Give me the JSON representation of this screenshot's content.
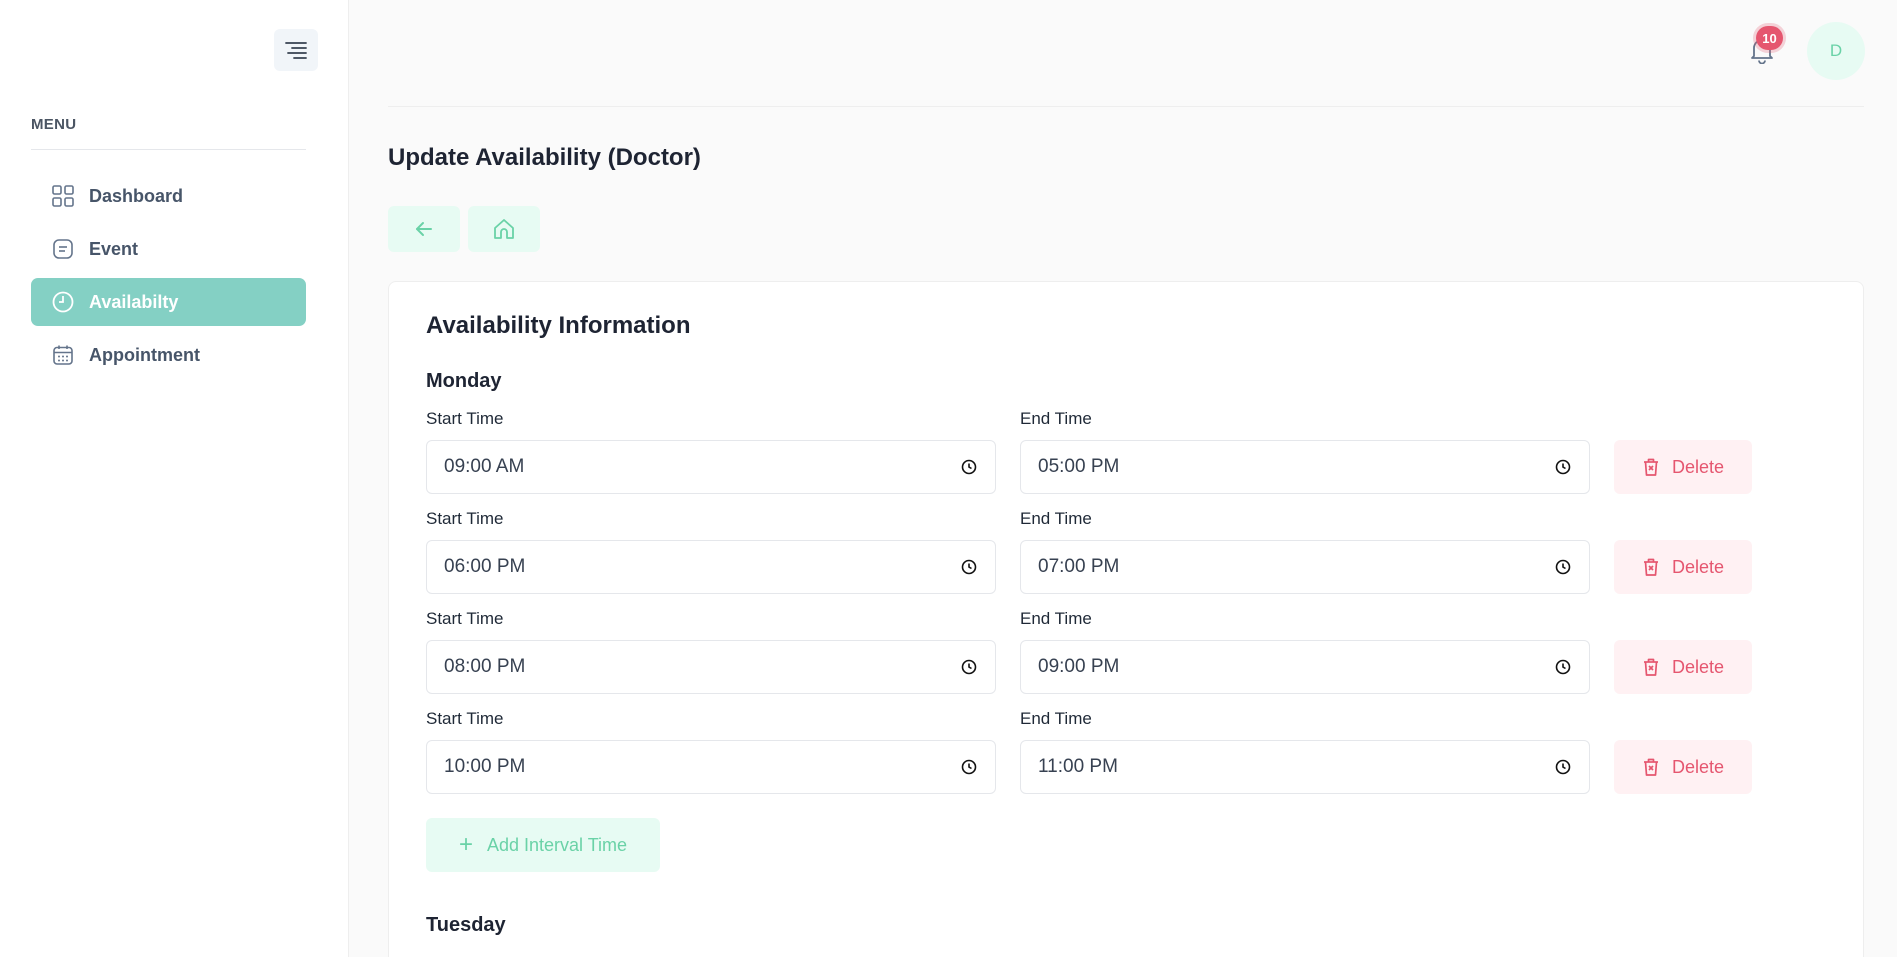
{
  "sidebar": {
    "menu_title": "MENU",
    "items": [
      {
        "label": "Dashboard",
        "icon": "grid-icon",
        "active": false
      },
      {
        "label": "Event",
        "icon": "note-icon",
        "active": false
      },
      {
        "label": "Availabilty",
        "icon": "clock-icon",
        "active": true
      },
      {
        "label": "Appointment",
        "icon": "calendar-icon",
        "active": false
      }
    ]
  },
  "header": {
    "notification_count": "10",
    "avatar_initial": "D"
  },
  "page": {
    "title": "Update Availability (Doctor)"
  },
  "card": {
    "title": "Availability Information",
    "days": [
      {
        "name": "Monday",
        "intervals": [
          {
            "start_label": "Start Time",
            "start": "09:00 AM",
            "end_label": "End Time",
            "end": "05:00 PM",
            "delete_label": "Delete"
          },
          {
            "start_label": "Start Time",
            "start": "06:00 PM",
            "end_label": "End Time",
            "end": "07:00 PM",
            "delete_label": "Delete"
          },
          {
            "start_label": "Start Time",
            "start": "08:00 PM",
            "end_label": "End Time",
            "end": "09:00 PM",
            "delete_label": "Delete"
          },
          {
            "start_label": "Start Time",
            "start": "10:00 PM",
            "end_label": "End Time",
            "end": "11:00 PM",
            "delete_label": "Delete"
          }
        ],
        "add_label": "Add Interval Time"
      },
      {
        "name": "Tuesday"
      }
    ]
  },
  "colors": {
    "accent": "#84d0c4",
    "accent_light": "#e7fbf3",
    "danger": "#e5566f",
    "danger_light": "#fff1f3"
  }
}
